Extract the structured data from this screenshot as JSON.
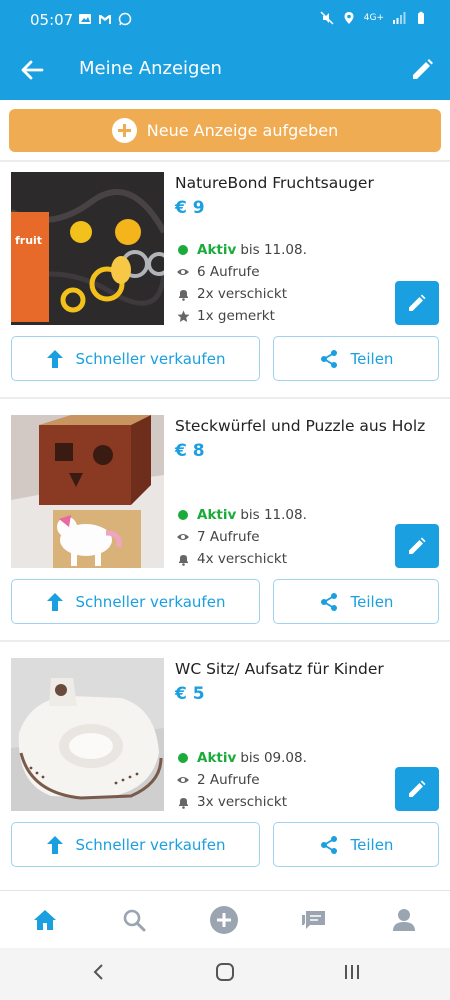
{
  "status_bar": {
    "time": "05:07",
    "network": "4G+"
  },
  "app_bar": {
    "title": "Meine Anzeigen"
  },
  "new_ad_button": {
    "label": "Neue Anzeige aufgeben"
  },
  "listings": [
    {
      "title": "NatureBond Fruchtsauger",
      "price": "€ 9",
      "status": "Aktiv",
      "until": "bis 11.08.",
      "views": "6 Aufrufe",
      "sent": "2x verschickt",
      "saved": "1x gemerkt",
      "image_text": "fruit"
    },
    {
      "title": "Steckwürfel und Puzzle aus Holz",
      "price": "€ 8",
      "status": "Aktiv",
      "until": "bis 11.08.",
      "views": "7 Aufrufe",
      "sent": "4x verschickt"
    },
    {
      "title": "WC Sitz/ Aufsatz für Kinder",
      "price": "€ 5",
      "status": "Aktiv",
      "until": "bis 09.08.",
      "views": "2 Aufrufe",
      "sent": "3x verschickt"
    }
  ],
  "actions": {
    "sell_faster": "Schneller verkaufen",
    "share": "Teilen"
  },
  "colors": {
    "primary": "#1a9fe0",
    "accent": "#f0ac52",
    "active": "#1bab3b"
  },
  "bottom_nav": [
    "home-icon",
    "search-icon",
    "add-circle-icon",
    "messages-icon",
    "profile-icon"
  ]
}
